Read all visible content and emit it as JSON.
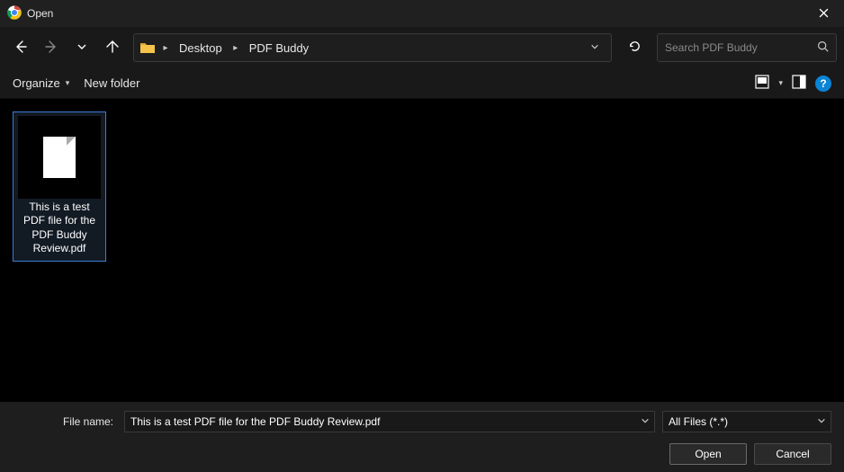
{
  "titlebar": {
    "title": "Open"
  },
  "nav": {
    "breadcrumb": {
      "items": [
        "Desktop",
        "PDF Buddy"
      ]
    },
    "search_placeholder": "Search PDF Buddy"
  },
  "toolbar": {
    "organize_label": "Organize",
    "newfolder_label": "New folder"
  },
  "files": {
    "items": [
      {
        "name": "This is a test PDF file for the PDF Buddy Review.pdf"
      }
    ]
  },
  "bottom": {
    "filename_label": "File name:",
    "filename_value": "This is a test PDF file for the PDF Buddy Review.pdf",
    "filter_value": "All Files (*.*)",
    "open_label": "Open",
    "cancel_label": "Cancel"
  }
}
